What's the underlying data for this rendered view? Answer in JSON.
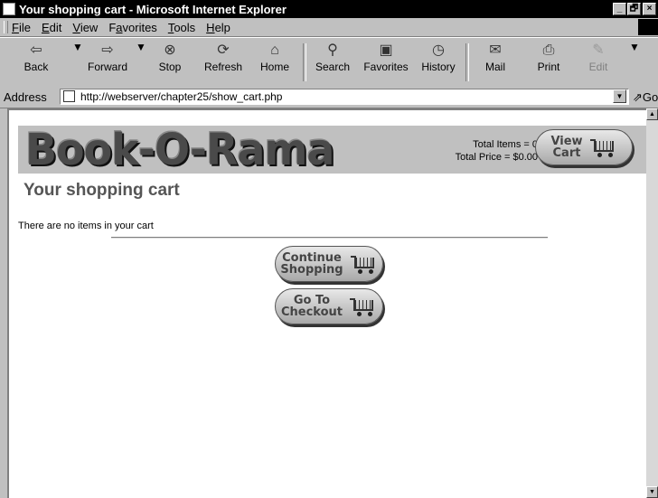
{
  "window": {
    "title": "Your shopping cart - Microsoft Internet Explorer",
    "controls": [
      "_",
      "🗗",
      "×"
    ]
  },
  "menu": {
    "items": [
      {
        "u": "F",
        "rest": "ile"
      },
      {
        "u": "E",
        "rest": "dit"
      },
      {
        "u": "V",
        "rest": "iew"
      },
      {
        "pre": "F",
        "u": "a",
        "rest": "vorites"
      },
      {
        "u": "T",
        "rest": "ools"
      },
      {
        "u": "H",
        "rest": "elp"
      }
    ]
  },
  "toolbar": {
    "back": "Back",
    "forward": "Forward",
    "stop": "Stop",
    "refresh": "Refresh",
    "home": "Home",
    "search": "Search",
    "favorites": "Favorites",
    "history": "History",
    "mail": "Mail",
    "print": "Print",
    "edit": "Edit"
  },
  "address": {
    "label": "Address",
    "url": "http://webserver/chapter25/show_cart.php",
    "go": "Go"
  },
  "page": {
    "logo": "Book-O-Rama",
    "total_items": "Total Items = 0",
    "total_price": "Total Price = $0.00",
    "view_cart_line1": "View",
    "view_cart_line2": "Cart",
    "heading": "Your shopping cart",
    "empty_message": "There are no items in your cart",
    "continue_line1": "Continue",
    "continue_line2": "Shopping",
    "checkout_line1": "Go To",
    "checkout_line2": "Checkout"
  }
}
